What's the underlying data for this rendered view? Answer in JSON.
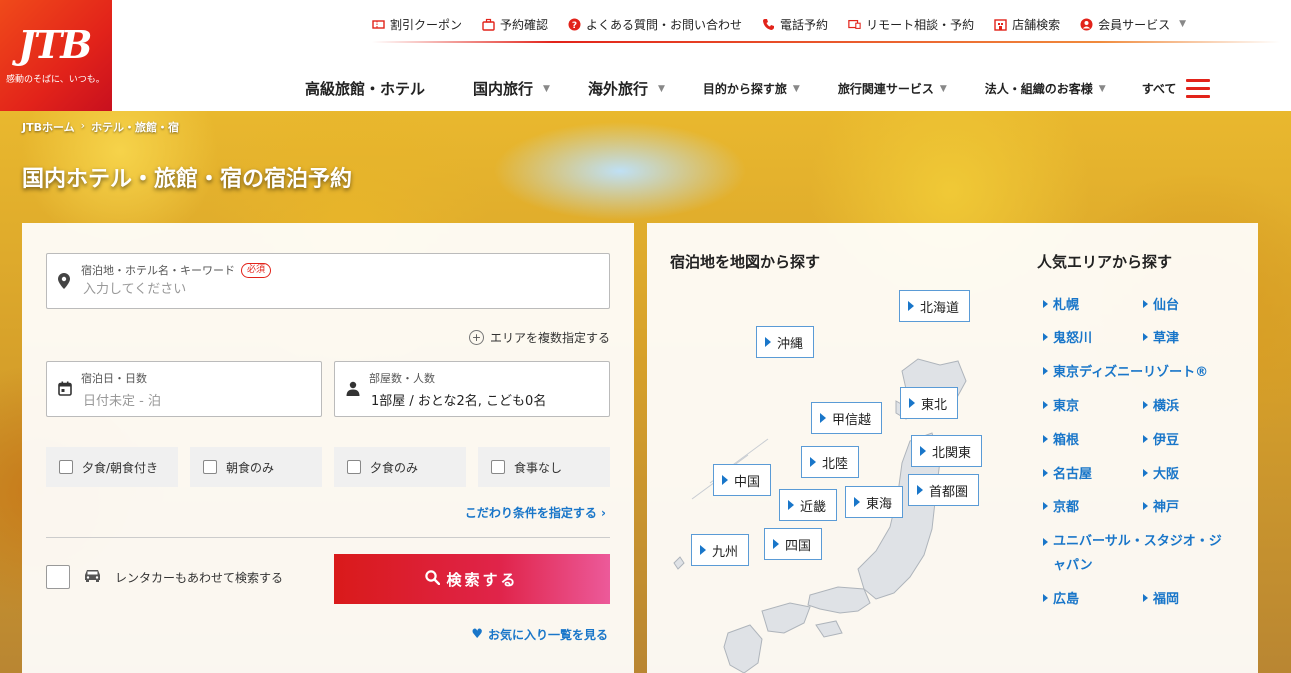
{
  "brand": {
    "logo_text": "JTB",
    "tagline": "感動のそばに、いつも。"
  },
  "utility_nav": [
    {
      "label": "割引クーポン",
      "icon": "coupon-icon"
    },
    {
      "label": "予約確認",
      "icon": "briefcase-icon"
    },
    {
      "label": "よくある質問・お問い合わせ",
      "icon": "question-icon"
    },
    {
      "label": "電話予約",
      "icon": "phone-icon"
    },
    {
      "label": "リモート相談・予約",
      "icon": "remote-consult-icon"
    },
    {
      "label": "店舗検索",
      "icon": "store-icon"
    },
    {
      "label": "会員サービス",
      "icon": "user-icon"
    }
  ],
  "main_nav": [
    {
      "label": "高級旅館・ホテル"
    },
    {
      "label": "国内旅行"
    },
    {
      "label": "海外旅行"
    },
    {
      "label": "目的から探す旅"
    },
    {
      "label": "旅行関連サービス"
    },
    {
      "label": "法人・組織のお客様"
    },
    {
      "label": "すべて"
    }
  ],
  "breadcrumb": {
    "home": "JTBホーム",
    "separator": "›",
    "current": "ホテル・旅館・宿"
  },
  "page_title": "国内ホテル・旅館・宿の宿泊予約",
  "search_form": {
    "destination": {
      "label": "宿泊地・ホテル名・キーワード",
      "required_badge": "必須",
      "placeholder": "入力してください"
    },
    "multi_area_link": "エリアを複数指定する",
    "dates": {
      "label": "宿泊日・日数",
      "placeholder": "日付未定 - 泊"
    },
    "rooms": {
      "label": "部屋数・人数",
      "value": "1部屋 / おとな2名, こども0名"
    },
    "meal_options": [
      {
        "label": "夕食/朝食付き"
      },
      {
        "label": "朝食のみ"
      },
      {
        "label": "夕食のみ"
      },
      {
        "label": "食事なし"
      }
    ],
    "conditions_link": "こだわり条件を指定する ›",
    "rentacar_label": "レンタカーもあわせて検索する",
    "search_button": "検索する",
    "favorites_link": "お気に入り一覧を見る"
  },
  "map_section": {
    "title": "宿泊地を地図から探す",
    "regions": [
      "北海道",
      "沖縄",
      "東北",
      "甲信越",
      "北関東",
      "北陸",
      "中国",
      "首都圏",
      "東海",
      "近畿",
      "九州",
      "四国"
    ]
  },
  "popular_section": {
    "title": "人気エリアから探す",
    "areas": [
      "札幌",
      "仙台",
      "鬼怒川",
      "草津",
      "東京ディズニーリゾート®",
      "東京",
      "横浜",
      "箱根",
      "伊豆",
      "名古屋",
      "大阪",
      "京都",
      "神戸",
      "ユニバーサル・スタジオ・ジャパン",
      "広島",
      "福岡"
    ]
  },
  "colors": {
    "brand_red": "#e2231a",
    "link_blue": "#1976c9"
  }
}
